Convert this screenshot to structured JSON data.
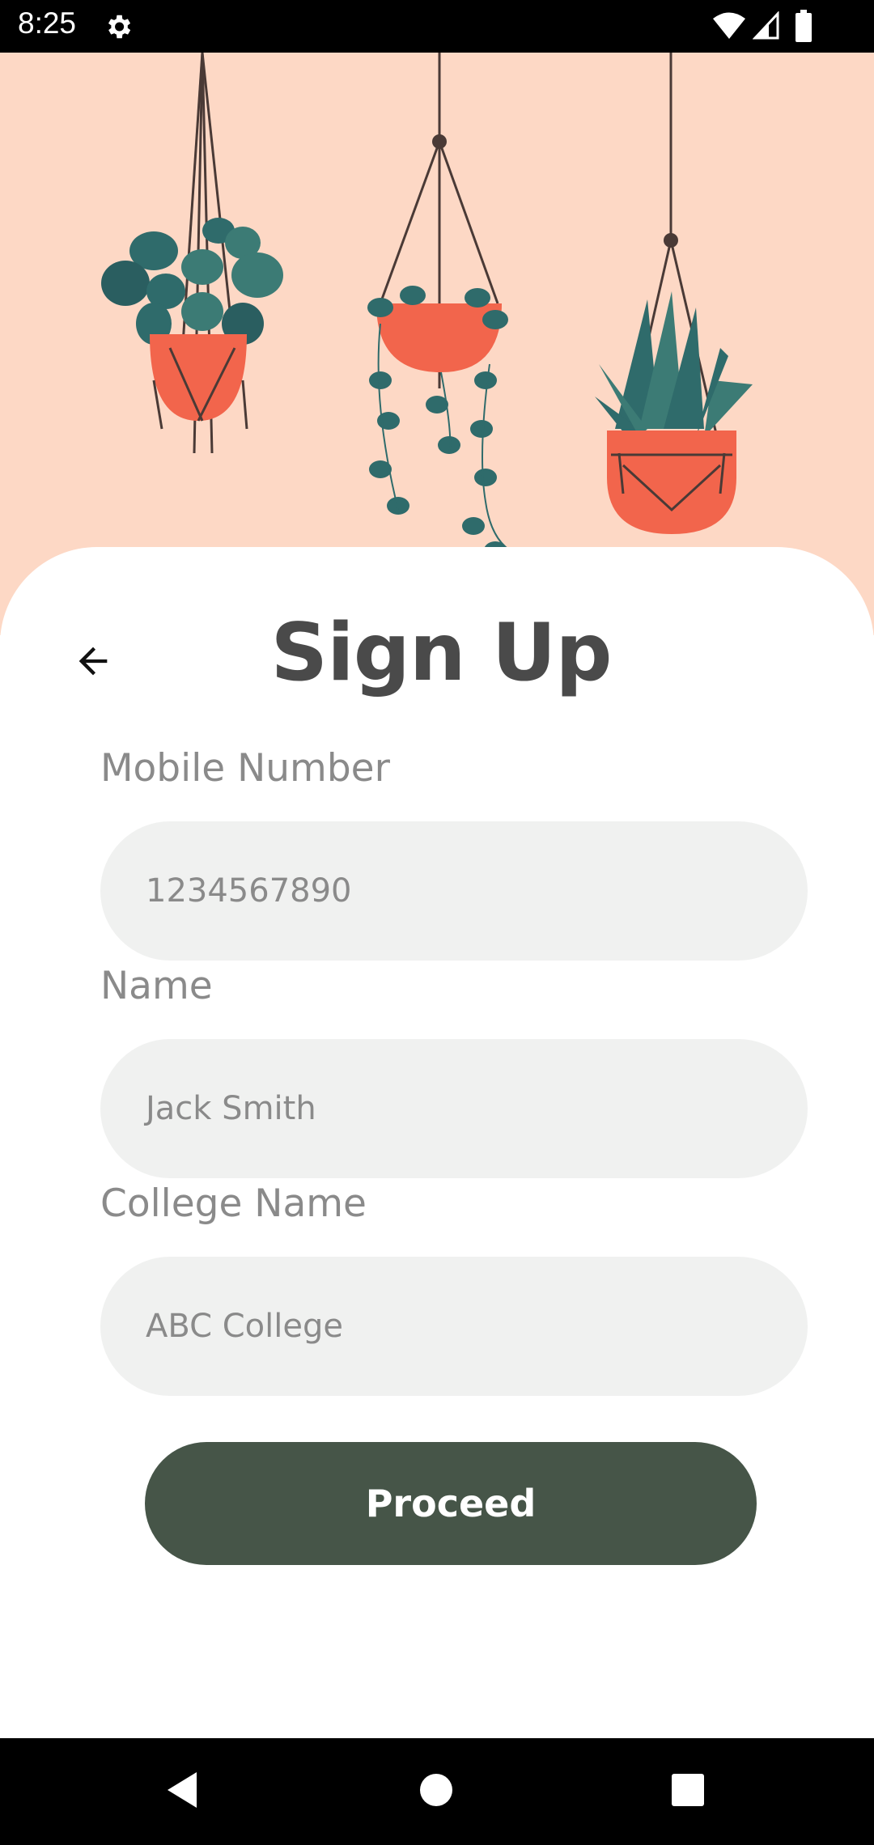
{
  "status_bar": {
    "time": "8:25",
    "icons": [
      "gear-icon",
      "wifi-icon",
      "signal-icon",
      "battery-icon"
    ]
  },
  "header": {
    "title": "Sign Up",
    "back_icon": "arrow-left-icon"
  },
  "form": {
    "mobile": {
      "label": "Mobile Number",
      "value": "1234567890"
    },
    "name": {
      "label": "Name",
      "value": "Jack Smith"
    },
    "college": {
      "label": "College Name",
      "value": "ABC College"
    },
    "submit_label": "Proceed"
  },
  "nav_bar": {
    "icons": [
      "nav-back-icon",
      "nav-home-icon",
      "nav-recents-icon"
    ]
  },
  "colors": {
    "hero_background": "#fdd8c5",
    "pot": "#f2654c",
    "leaf": "#2f6b6b",
    "button": "#465548",
    "field_background": "#f0f1f0",
    "title_text": "#4a4a4a",
    "label_text": "#8a8a8a"
  }
}
